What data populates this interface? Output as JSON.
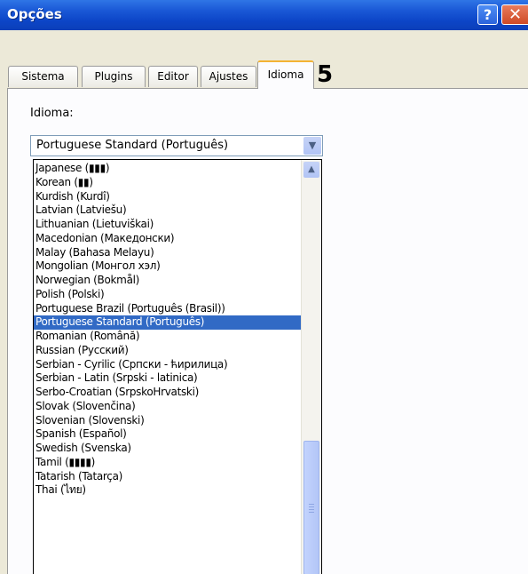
{
  "window": {
    "title": "Opções",
    "help_label": "?",
    "close_label": "✕"
  },
  "tabs": [
    {
      "label": "Sistema"
    },
    {
      "label": "Plugins"
    },
    {
      "label": "Editor"
    },
    {
      "label": "Ajustes"
    },
    {
      "label": "Idioma"
    }
  ],
  "annotation": {
    "step_number": "5"
  },
  "language": {
    "label": "Idioma:",
    "selected_value": "Portuguese Standard (Português)"
  },
  "dropdown": {
    "items": [
      {
        "label": "Japanese (▮▮▮)"
      },
      {
        "label": "Korean (▮▮)"
      },
      {
        "label": "Kurdish (Kurdî)"
      },
      {
        "label": "Latvian (Latviešu)"
      },
      {
        "label": "Lithuanian (Lietuviškai)"
      },
      {
        "label": "Macedonian (Македонски)"
      },
      {
        "label": "Malay (Bahasa Melayu)"
      },
      {
        "label": "Mongolian (Монгол хэл)"
      },
      {
        "label": "Norwegian (Bokmål)"
      },
      {
        "label": "Polish (Polski)"
      },
      {
        "label": "Portuguese Brazil (Português (Brasil))"
      },
      {
        "label": "Portuguese Standard (Português)"
      },
      {
        "label": "Romanian (Română)"
      },
      {
        "label": "Russian (Русский)"
      },
      {
        "label": "Serbian - Cyrilic (Српски - ћирилица)"
      },
      {
        "label": "Serbian - Latin (Srpski - latinica)"
      },
      {
        "label": "Serbo-Croatian (SrpskoHrvatski)"
      },
      {
        "label": "Slovak (Slovenčina)"
      },
      {
        "label": "Slovenian (Slovenski)"
      },
      {
        "label": "Spanish (Español)"
      },
      {
        "label": "Swedish (Svenska)"
      },
      {
        "label": "Tamil (▮▮▮▮)"
      },
      {
        "label": "Tatarish (Tatarça)"
      },
      {
        "label": "Thai (ไทย)"
      }
    ]
  },
  "colors": {
    "titlebar": "#0c45c7",
    "selection": "#316ac5",
    "active_tab_accent": "#f3b334"
  }
}
